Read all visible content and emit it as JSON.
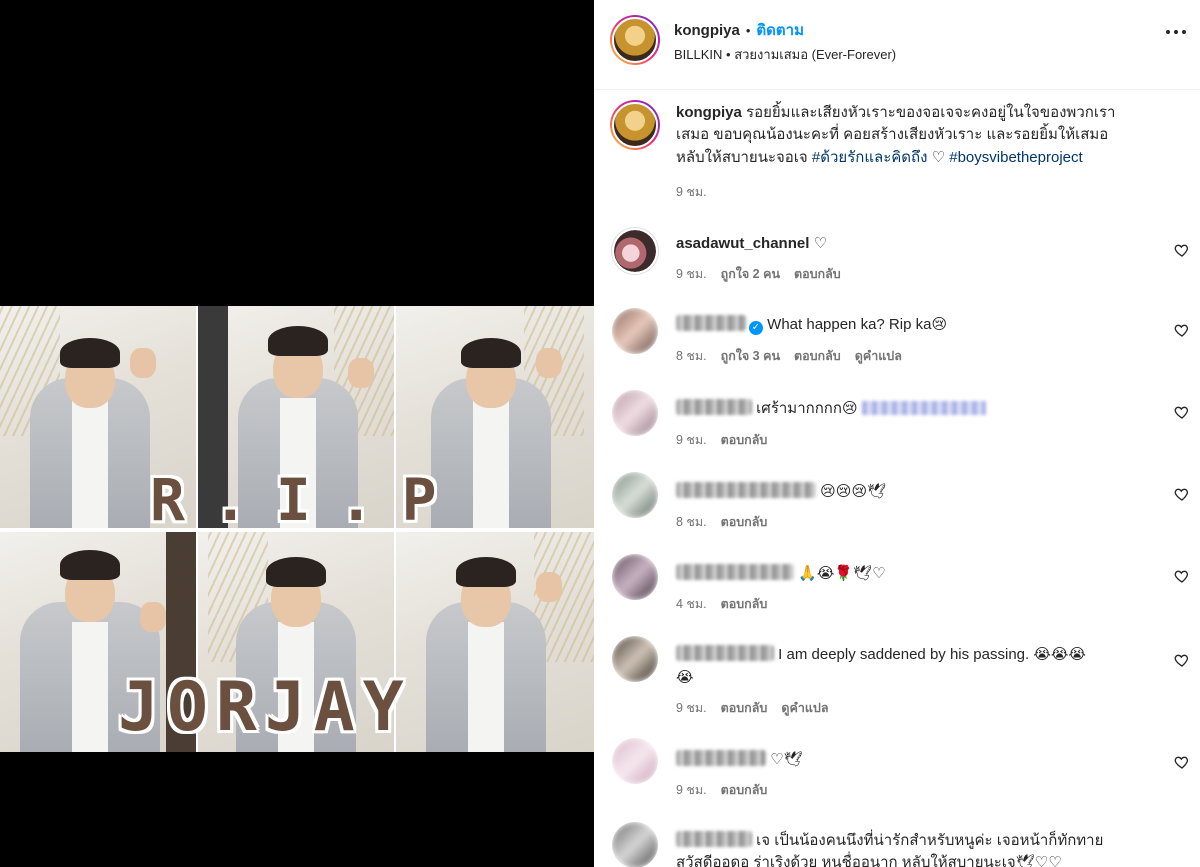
{
  "post": {
    "author": "kongpiya",
    "separator": "•",
    "follow_label": "ติดตาม",
    "audio": "BILLKIN • สวยงามเสมอ (Ever-Forever)"
  },
  "media": {
    "rip_text": "R.I.P",
    "name_text": "JORJAY"
  },
  "caption": {
    "author": "kongpiya",
    "line1": "รอยยิ้มและเสียงหัวเราะของจอเจจะคงอยู่ในใจของพวกเรา",
    "line2": "เสมอ ขอบคุณน้องนะคะที่ คอยสร้างเสียงหัวเราะ และรอยยิ้มให้เสมอ",
    "line3_text": "หลับให้สบายนะจอเจ",
    "hashtag1": "#ด้วยรักและคิดถึง",
    "heart": "♡",
    "hashtag2": "#boysvibetheproject",
    "time": "9 ชม."
  },
  "comments": [
    {
      "user": "asadawut_channel",
      "text": "♡",
      "time": "9 ชม.",
      "likes": "ถูกใจ 2 คน",
      "reply": "ตอบกลับ"
    },
    {
      "user": "",
      "text": "What happen ka? Rip ka😢",
      "time": "8 ชม.",
      "likes": "ถูกใจ 3 คน",
      "reply": "ตอบกลับ",
      "translate": "ดูคำแปล"
    },
    {
      "user": "",
      "text": "เศร้ามากกกก😢",
      "time": "9 ชม.",
      "reply": "ตอบกลับ"
    },
    {
      "user": "",
      "text": "😢😢😢🕊",
      "time": "8 ชม.",
      "reply": "ตอบกลับ"
    },
    {
      "user": "",
      "text": "🙏😭🌹🕊♡",
      "time": "4 ชม.",
      "reply": "ตอบกลับ"
    },
    {
      "user": "",
      "text": "I am deeply saddened by his passing. 😭😭😭",
      "text2": "😭",
      "time": "9 ชม.",
      "reply": "ตอบกลับ",
      "translate": "ดูคำแปล"
    },
    {
      "user": "",
      "text": "♡🕊",
      "time": "9 ชม.",
      "reply": "ตอบกลับ"
    },
    {
      "user": "",
      "text": "เจ เป็นน้องคนนึงที่น่ารักสำหรับหนูค่ะ เจอหน้าก็ทักทาย",
      "text2": "สวัสดีออดอ ร่าเริงด้วย หนูชื่ออนาก หลับให้สบายนะเจ🕊♡♡"
    }
  ],
  "icons": {
    "more": "more-horizontal-icon",
    "heart": "heart-outline-icon",
    "verified": "verified-badge-icon"
  },
  "colors": {
    "link": "#0095f6",
    "hashtag": "#00376b",
    "muted": "#737373",
    "text": "#262626"
  }
}
